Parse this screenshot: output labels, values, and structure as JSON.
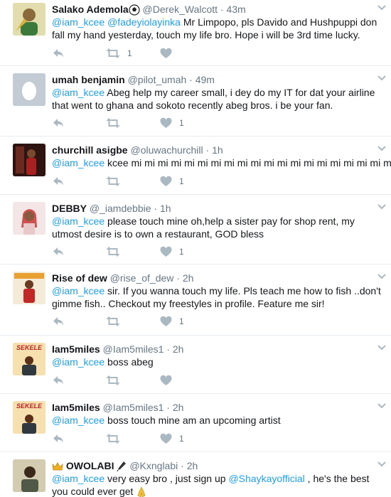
{
  "tweets": [
    {
      "name": "Salako Ademola",
      "handle": "@Derek_Walcott",
      "time": "43m",
      "text_parts": [
        {
          "t": "@iam_kcee",
          "mention": true
        },
        {
          "t": " "
        },
        {
          "t": "@fadeyiolayinka",
          "mention": true
        },
        {
          "t": " Mr Limpopo, pls Davido and Hushpuppi don fall my hand yesterday, touch my life bro. Hope i will be 3rd time lucky."
        }
      ],
      "retweets": "1",
      "likes": ""
    },
    {
      "name": "umah benjamin",
      "handle": "@pilot_umah",
      "time": "49m",
      "text_parts": [
        {
          "t": "@iam_kcee",
          "mention": true
        },
        {
          "t": " Abeg help my career small, i dey do my IT for dat your airline that went to ghana and sokoto recently abeg bros. i be your fan."
        }
      ],
      "retweets": "",
      "likes": "1"
    },
    {
      "name": "churchill asigbe",
      "handle": "@oluwachurchill",
      "time": "1h",
      "text_parts": [
        {
          "t": "@iam_kcee",
          "mention": true
        },
        {
          "t": " kcee mi mi mi mi mi mi mi mi mi mi mi mi mi mi mi mi mi mi mi mi"
        }
      ],
      "retweets": "",
      "likes": "1"
    },
    {
      "name": "DEBBY",
      "handle": "@_iamdebbie",
      "time": "1h",
      "text_parts": [
        {
          "t": "@iam_kcee",
          "mention": true
        },
        {
          "t": " please touch mine oh,help a sister pay for shop rent, my utmost desire is to own a restaurant, GOD bless"
        }
      ],
      "retweets": "",
      "likes": "1"
    },
    {
      "name": "Rise of dew",
      "handle": "@rise_of_dew",
      "time": "2h",
      "text_parts": [
        {
          "t": "@iam_kcee",
          "mention": true
        },
        {
          "t": " sir. If you wanna touch my life. Pls teach me how to fish ..don't gimme fish.. Checkout my freestyles in profile. Feature me sir!"
        }
      ],
      "retweets": "",
      "likes": "1"
    },
    {
      "name": "Iam5miles",
      "handle": "@Iam5miles1",
      "time": "2h",
      "avatar_text": "SEKELE",
      "text_parts": [
        {
          "t": "@iam_kcee",
          "mention": true
        },
        {
          "t": " boss abeg"
        }
      ],
      "retweets": "",
      "likes": ""
    },
    {
      "name": "Iam5miles",
      "handle": "@Iam5miles1",
      "time": "2h",
      "avatar_text": "SEKELE",
      "text_parts": [
        {
          "t": "@iam_kcee",
          "mention": true
        },
        {
          "t": " boss touch mine am an upcoming artist"
        }
      ],
      "retweets": "",
      "likes": "1"
    },
    {
      "name": "OWOLABI",
      "handle": "@Kxnglabi",
      "time": "2h",
      "text_parts": [
        {
          "t": "@iam_kcee",
          "mention": true
        },
        {
          "t": " very easy bro , just sign up "
        },
        {
          "t": "@Shaykayofficial",
          "mention": true
        },
        {
          "t": " , he's the best you could ever get "
        }
      ],
      "retweets": "",
      "likes": ""
    }
  ],
  "colors": {
    "text": "#14171a",
    "muted": "#657786",
    "link": "#1da1f2",
    "icon": "#aab8c2",
    "divider": "#e6ecf0"
  },
  "icons": [
    "reply-icon",
    "retweet-icon",
    "like-icon",
    "chevron-down-icon",
    "soccer-ball-icon",
    "crown-icon",
    "pen-nib-icon",
    "praying-hands-icon"
  ]
}
